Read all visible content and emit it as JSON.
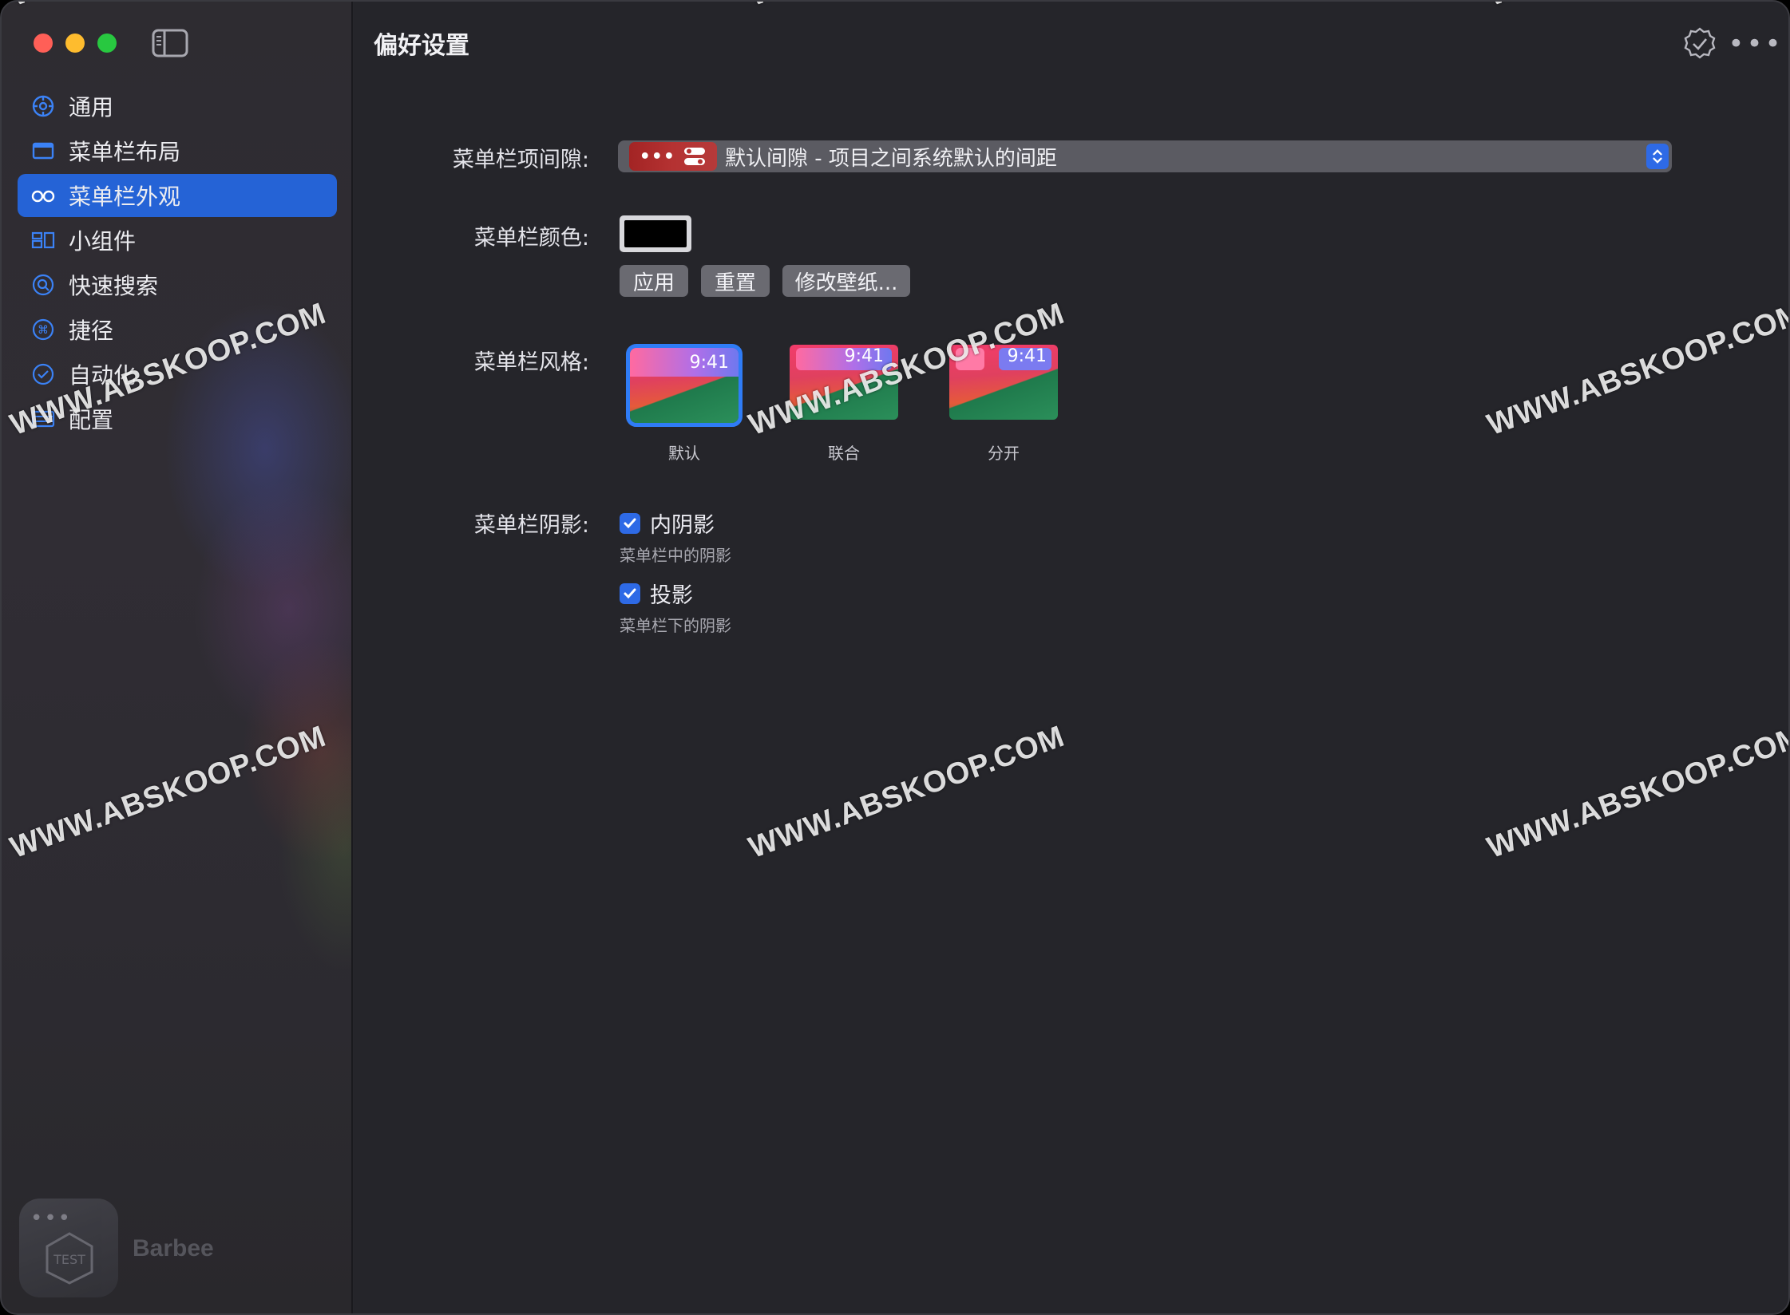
{
  "window": {
    "title": "偏好设置"
  },
  "sidebar": {
    "items": [
      {
        "label": "通用",
        "icon": "gear-icon"
      },
      {
        "label": "菜单栏布局",
        "icon": "window-icon"
      },
      {
        "label": "菜单栏外观",
        "icon": "glasses-icon",
        "active": true
      },
      {
        "label": "小组件",
        "icon": "widgets-icon"
      },
      {
        "label": "快速搜索",
        "icon": "search-circle-icon"
      },
      {
        "label": "捷径",
        "icon": "command-circle-icon"
      },
      {
        "label": "自动化",
        "icon": "clock-check-icon"
      },
      {
        "label": "配置",
        "icon": "list-icon"
      }
    ],
    "app_name": "Barbee",
    "app_badge_text": "TEST",
    "accent": "#2563d6"
  },
  "main": {
    "spacing": {
      "label": "菜单栏项间隙:",
      "value": "默认间隙 - 项目之间系统默认的间距"
    },
    "color": {
      "label": "菜单栏颜色:",
      "swatch": "#000000",
      "buttons": [
        "应用",
        "重置",
        "修改壁纸..."
      ]
    },
    "style": {
      "label": "菜单栏风格:",
      "options": [
        {
          "label": "默认",
          "time": "9:41",
          "selected": true
        },
        {
          "label": "联合",
          "time": "9:41"
        },
        {
          "label": "分开",
          "time": "9:41"
        }
      ]
    },
    "shadow": {
      "label": "菜单栏阴影:",
      "options": [
        {
          "label": "内阴影",
          "description": "菜单栏中的阴影",
          "checked": true
        },
        {
          "label": "投影",
          "description": "菜单栏下的阴影",
          "checked": true
        }
      ]
    }
  },
  "watermark": "WWW.ABSKOOP.COM",
  "watermark_top": "WWW."
}
